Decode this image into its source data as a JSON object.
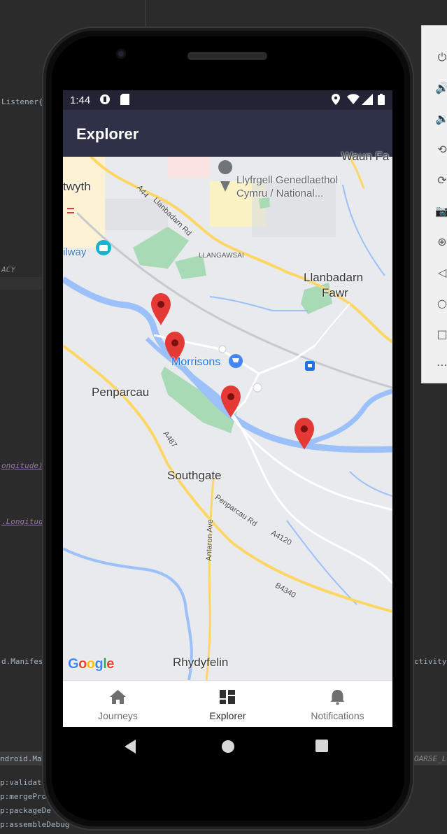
{
  "ide": {
    "fragments": [
      "Listener{",
      "ACY",
      "ongitude)",
      ".Longitud",
      "d.Manifes",
      "ctivity",
      "ndroid.Ma",
      "OARSE_L",
      "p:validat",
      "p:mergePro",
      "p:packageDe",
      "p:assembleDebug"
    ]
  },
  "emulator_toolbar": {
    "icons": [
      "power-icon",
      "volume-up-icon",
      "volume-down-icon",
      "rotate-left-icon",
      "rotate-right-icon",
      "screenshot-icon",
      "zoom-icon",
      "back-icon",
      "home-icon",
      "overview-icon",
      "more-icon"
    ]
  },
  "status_bar": {
    "time": "1:44",
    "icons": [
      "location-icon",
      "wifi-icon",
      "signal-icon",
      "battery-icon"
    ]
  },
  "app_bar": {
    "title": "Explorer"
  },
  "map": {
    "labels": {
      "waun_fawr": "Waun Fa",
      "aberystwyth": "twyth",
      "library": "Llyfrgell Genedlaethol",
      "library2": "Cymru / National...",
      "railway": "ilway",
      "llangawsai": "LLANGAWSAI",
      "llanbadarn": "Llanbadarn",
      "fawr": "Fawr",
      "morrisons": "Morrisons",
      "penparcau": "Penparcau",
      "southgate": "Southgate",
      "rhydyfelin": "Rhydyfelin",
      "a44": "A44",
      "llanbadarn_rd": "Llanbadarn Rd",
      "a487": "A487",
      "penparcau_rd": "Penparcau Rd",
      "a4120": "A4120",
      "antaron_ave": "Antaron Ave",
      "b4340": "B4340"
    },
    "marker_color": "#e53935",
    "google_logo": [
      "G",
      "o",
      "o",
      "g",
      "l",
      "e"
    ]
  },
  "bottom_nav": {
    "items": [
      {
        "label": "Journeys",
        "icon": "home-icon",
        "active": false
      },
      {
        "label": "Explorer",
        "icon": "dashboard-icon",
        "active": true
      },
      {
        "label": "Notifications",
        "icon": "bell-icon",
        "active": false
      }
    ]
  },
  "colors": {
    "status_bar": "#222436",
    "app_bar": "#2f3149",
    "water": "#9cc0f9",
    "park": "#a8dab5",
    "major_road": "#fdd663",
    "marker": "#e53935"
  }
}
